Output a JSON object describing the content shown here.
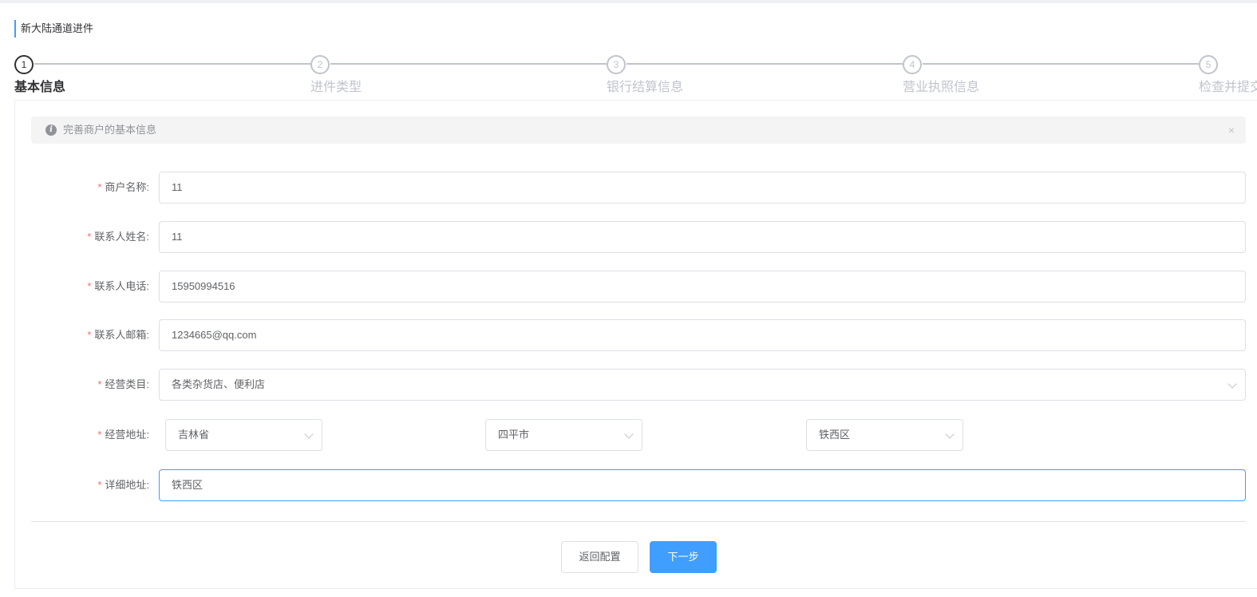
{
  "page": {
    "title": "新大陆通道进件"
  },
  "steps": [
    {
      "number": "1",
      "title": "基本信息"
    },
    {
      "number": "2",
      "title": "进件类型"
    },
    {
      "number": "3",
      "title": "银行结算信息"
    },
    {
      "number": "4",
      "title": "营业执照信息"
    },
    {
      "number": "5",
      "title": "检查并提交"
    }
  ],
  "alert": {
    "text": "完善商户的基本信息",
    "close": "×",
    "icon": "info-icon"
  },
  "form": {
    "merchant_name": {
      "label": "商户名称:",
      "value": "11"
    },
    "contact_name": {
      "label": "联系人姓名:",
      "value": "11"
    },
    "contact_phone": {
      "label": "联系人电话:",
      "value": "15950994516"
    },
    "contact_email": {
      "label": "联系人邮箱:",
      "value": "1234665@qq.com"
    },
    "business_category": {
      "label": "经营类目:",
      "value": "各类杂货店、便利店"
    },
    "business_address": {
      "label": "经营地址:",
      "province": "吉林省",
      "city": "四平市",
      "district": "铁西区"
    },
    "detail_address": {
      "label": "详细地址:",
      "value": "铁西区"
    },
    "required_mark": "*"
  },
  "buttons": {
    "back": "返回配置",
    "next": "下一步"
  },
  "colors": {
    "primary": "#409eff",
    "required": "#f56c6c",
    "active_step": "#303133",
    "inactive_step": "#c0c4cc"
  }
}
